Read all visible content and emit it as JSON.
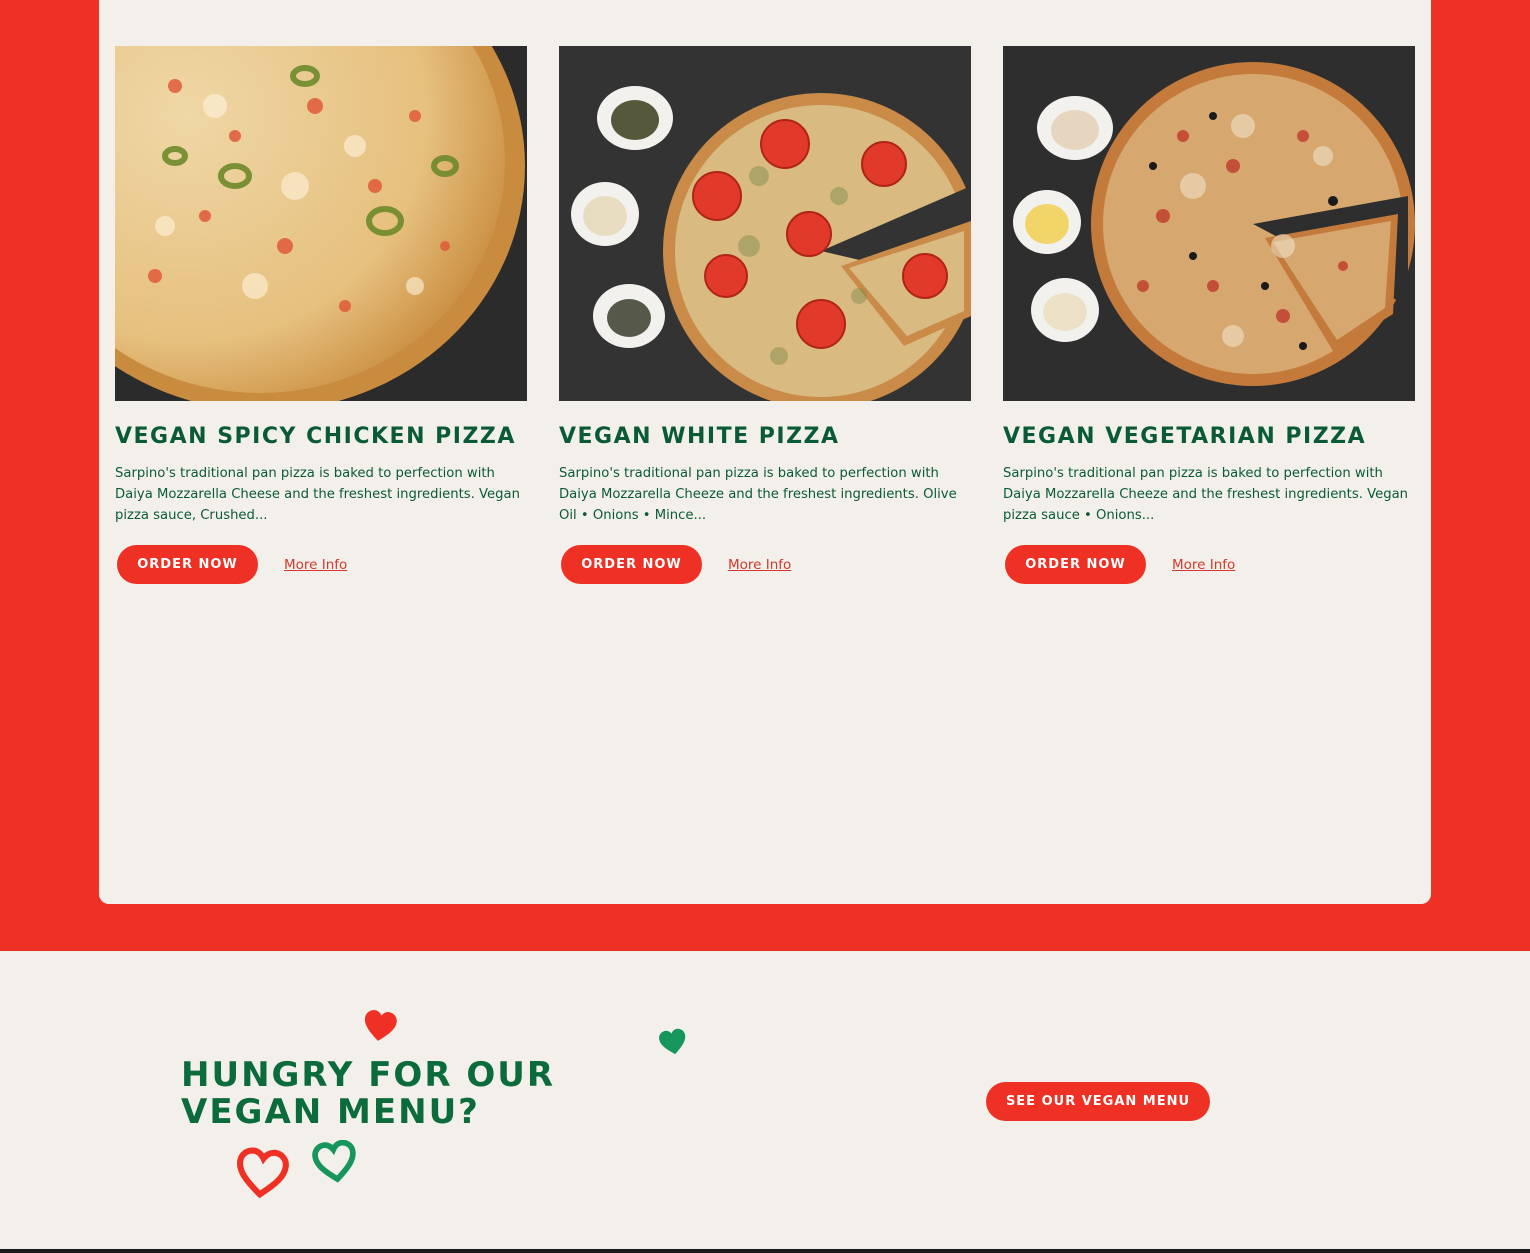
{
  "products": [
    {
      "title": "Vegan Spicy Chicken Pizza",
      "description": "Sarpino's traditional pan pizza is baked to perfection with Daiya Mozzarella Cheese and the freshest ingredients. Vegan pizza sauce, Crushed...",
      "order_label": "ORDER NOW",
      "more_info_label": "More Info"
    },
    {
      "title": "Vegan White Pizza",
      "description": "Sarpino's traditional pan pizza is baked to perfection with Daiya Mozzarella Cheeze and the freshest ingredients. Olive Oil • Onions • Mince...",
      "order_label": "ORDER NOW",
      "more_info_label": "More Info"
    },
    {
      "title": "Vegan Vegetarian Pizza",
      "description": "Sarpino's traditional pan pizza is baked to perfection with Daiya Mozzarella Cheeze and the freshest ingredients. Vegan pizza sauce • Onions...",
      "order_label": "ORDER NOW",
      "more_info_label": "More Info"
    }
  ],
  "cta": {
    "heading": "Hungry for our vegan menu?",
    "button_label": "SEE OUR VEGAN MENU"
  },
  "colors": {
    "brand_red": "#ee3124",
    "brand_green": "#0b5a37",
    "heart_green": "#16965a",
    "card_background": "#f3f0eb"
  },
  "icons": {
    "heart_solid_red": "heart-icon",
    "heart_solid_green": "heart-icon",
    "heart_outline_red": "heart-outline-icon",
    "heart_outline_green": "heart-outline-icon"
  }
}
